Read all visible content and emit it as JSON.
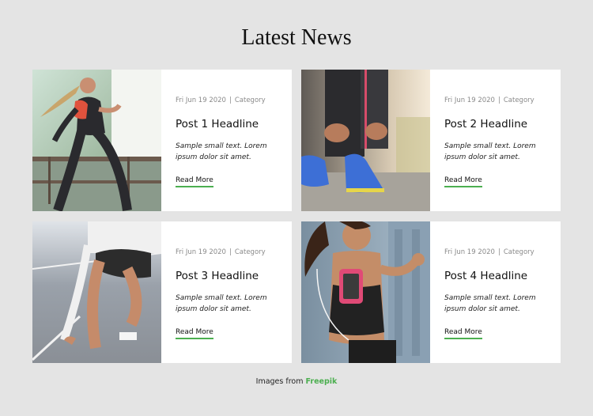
{
  "page": {
    "title": "Latest News"
  },
  "posts": [
    {
      "date": "Fri Jun 19 2020",
      "separator": "|",
      "category": "Category",
      "headline": "Post 1 Headline",
      "excerpt": "Sample small text. Lorem ipsum dolor sit amet.",
      "read_more": "Read More",
      "image_icon": "woman-running-photo"
    },
    {
      "date": "Fri Jun 19 2020",
      "separator": "|",
      "category": "Category",
      "headline": "Post 2 Headline",
      "excerpt": "Sample small text. Lorem ipsum dolor sit amet.",
      "read_more": "Read More",
      "image_icon": "tying-shoelace-photo"
    },
    {
      "date": "Fri Jun 19 2020",
      "separator": "|",
      "category": "Category",
      "headline": "Post 3 Headline",
      "excerpt": "Sample small text. Lorem ipsum dolor sit amet.",
      "read_more": "Read More",
      "image_icon": "sprint-start-photo"
    },
    {
      "date": "Fri Jun 19 2020",
      "separator": "|",
      "category": "Category",
      "headline": "Post 4 Headline",
      "excerpt": "Sample small text. Lorem ipsum dolor sit amet.",
      "read_more": "Read More",
      "image_icon": "woman-armband-photo"
    }
  ],
  "footer": {
    "prefix": "Images from",
    "link_label": "Freepik"
  },
  "colors": {
    "background": "#e4e4e4",
    "card": "#ffffff",
    "accent": "#4caf50"
  }
}
